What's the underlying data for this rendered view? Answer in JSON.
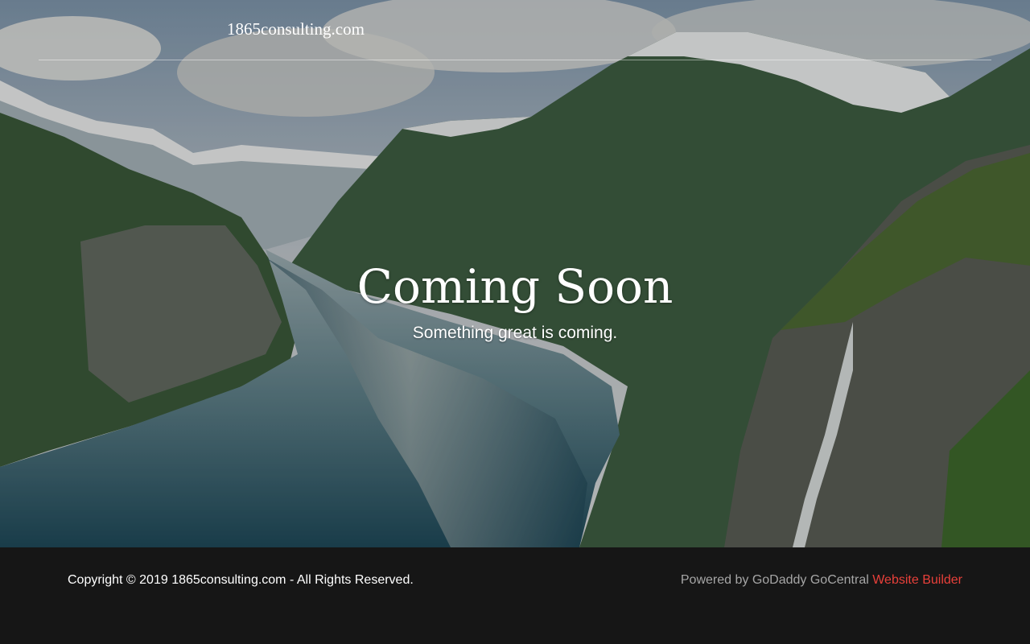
{
  "header": {
    "brand": "1865consulting.com"
  },
  "hero": {
    "title": "Coming Soon",
    "subtitle": "Something great is coming."
  },
  "footer": {
    "copyright": "Copyright © 2019 1865consulting.com - All Rights Reserved.",
    "powered_prefix": "Powered by GoDaddy GoCentral",
    "powered_link": "Website Builder"
  },
  "colors": {
    "footer_bg": "#161616",
    "link_red": "#e8403a",
    "muted_text": "#a6a6a6"
  },
  "background_image": "fjord-landscape-with-waterfall"
}
